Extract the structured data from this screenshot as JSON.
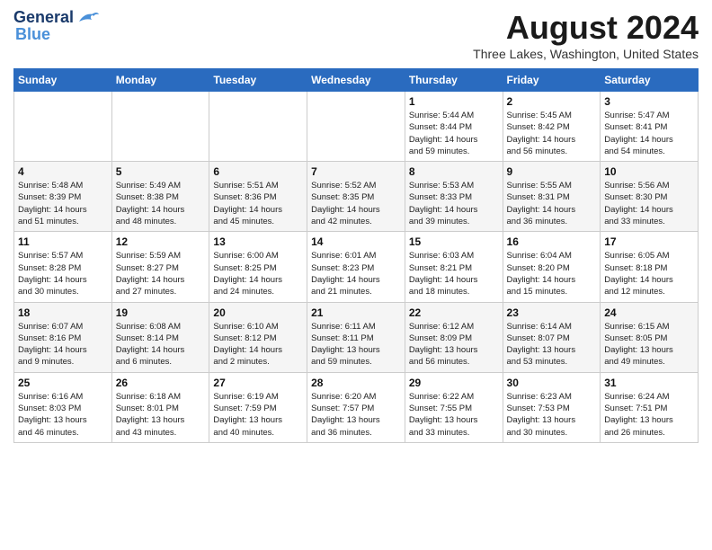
{
  "header": {
    "logo_line1": "General",
    "logo_line2": "Blue",
    "month_year": "August 2024",
    "location": "Three Lakes, Washington, United States"
  },
  "weekdays": [
    "Sunday",
    "Monday",
    "Tuesday",
    "Wednesday",
    "Thursday",
    "Friday",
    "Saturday"
  ],
  "weeks": [
    [
      {
        "day": "",
        "info": ""
      },
      {
        "day": "",
        "info": ""
      },
      {
        "day": "",
        "info": ""
      },
      {
        "day": "",
        "info": ""
      },
      {
        "day": "1",
        "info": "Sunrise: 5:44 AM\nSunset: 8:44 PM\nDaylight: 14 hours\nand 59 minutes."
      },
      {
        "day": "2",
        "info": "Sunrise: 5:45 AM\nSunset: 8:42 PM\nDaylight: 14 hours\nand 56 minutes."
      },
      {
        "day": "3",
        "info": "Sunrise: 5:47 AM\nSunset: 8:41 PM\nDaylight: 14 hours\nand 54 minutes."
      }
    ],
    [
      {
        "day": "4",
        "info": "Sunrise: 5:48 AM\nSunset: 8:39 PM\nDaylight: 14 hours\nand 51 minutes."
      },
      {
        "day": "5",
        "info": "Sunrise: 5:49 AM\nSunset: 8:38 PM\nDaylight: 14 hours\nand 48 minutes."
      },
      {
        "day": "6",
        "info": "Sunrise: 5:51 AM\nSunset: 8:36 PM\nDaylight: 14 hours\nand 45 minutes."
      },
      {
        "day": "7",
        "info": "Sunrise: 5:52 AM\nSunset: 8:35 PM\nDaylight: 14 hours\nand 42 minutes."
      },
      {
        "day": "8",
        "info": "Sunrise: 5:53 AM\nSunset: 8:33 PM\nDaylight: 14 hours\nand 39 minutes."
      },
      {
        "day": "9",
        "info": "Sunrise: 5:55 AM\nSunset: 8:31 PM\nDaylight: 14 hours\nand 36 minutes."
      },
      {
        "day": "10",
        "info": "Sunrise: 5:56 AM\nSunset: 8:30 PM\nDaylight: 14 hours\nand 33 minutes."
      }
    ],
    [
      {
        "day": "11",
        "info": "Sunrise: 5:57 AM\nSunset: 8:28 PM\nDaylight: 14 hours\nand 30 minutes."
      },
      {
        "day": "12",
        "info": "Sunrise: 5:59 AM\nSunset: 8:27 PM\nDaylight: 14 hours\nand 27 minutes."
      },
      {
        "day": "13",
        "info": "Sunrise: 6:00 AM\nSunset: 8:25 PM\nDaylight: 14 hours\nand 24 minutes."
      },
      {
        "day": "14",
        "info": "Sunrise: 6:01 AM\nSunset: 8:23 PM\nDaylight: 14 hours\nand 21 minutes."
      },
      {
        "day": "15",
        "info": "Sunrise: 6:03 AM\nSunset: 8:21 PM\nDaylight: 14 hours\nand 18 minutes."
      },
      {
        "day": "16",
        "info": "Sunrise: 6:04 AM\nSunset: 8:20 PM\nDaylight: 14 hours\nand 15 minutes."
      },
      {
        "day": "17",
        "info": "Sunrise: 6:05 AM\nSunset: 8:18 PM\nDaylight: 14 hours\nand 12 minutes."
      }
    ],
    [
      {
        "day": "18",
        "info": "Sunrise: 6:07 AM\nSunset: 8:16 PM\nDaylight: 14 hours\nand 9 minutes."
      },
      {
        "day": "19",
        "info": "Sunrise: 6:08 AM\nSunset: 8:14 PM\nDaylight: 14 hours\nand 6 minutes."
      },
      {
        "day": "20",
        "info": "Sunrise: 6:10 AM\nSunset: 8:12 PM\nDaylight: 14 hours\nand 2 minutes."
      },
      {
        "day": "21",
        "info": "Sunrise: 6:11 AM\nSunset: 8:11 PM\nDaylight: 13 hours\nand 59 minutes."
      },
      {
        "day": "22",
        "info": "Sunrise: 6:12 AM\nSunset: 8:09 PM\nDaylight: 13 hours\nand 56 minutes."
      },
      {
        "day": "23",
        "info": "Sunrise: 6:14 AM\nSunset: 8:07 PM\nDaylight: 13 hours\nand 53 minutes."
      },
      {
        "day": "24",
        "info": "Sunrise: 6:15 AM\nSunset: 8:05 PM\nDaylight: 13 hours\nand 49 minutes."
      }
    ],
    [
      {
        "day": "25",
        "info": "Sunrise: 6:16 AM\nSunset: 8:03 PM\nDaylight: 13 hours\nand 46 minutes."
      },
      {
        "day": "26",
        "info": "Sunrise: 6:18 AM\nSunset: 8:01 PM\nDaylight: 13 hours\nand 43 minutes."
      },
      {
        "day": "27",
        "info": "Sunrise: 6:19 AM\nSunset: 7:59 PM\nDaylight: 13 hours\nand 40 minutes."
      },
      {
        "day": "28",
        "info": "Sunrise: 6:20 AM\nSunset: 7:57 PM\nDaylight: 13 hours\nand 36 minutes."
      },
      {
        "day": "29",
        "info": "Sunrise: 6:22 AM\nSunset: 7:55 PM\nDaylight: 13 hours\nand 33 minutes."
      },
      {
        "day": "30",
        "info": "Sunrise: 6:23 AM\nSunset: 7:53 PM\nDaylight: 13 hours\nand 30 minutes."
      },
      {
        "day": "31",
        "info": "Sunrise: 6:24 AM\nSunset: 7:51 PM\nDaylight: 13 hours\nand 26 minutes."
      }
    ]
  ]
}
